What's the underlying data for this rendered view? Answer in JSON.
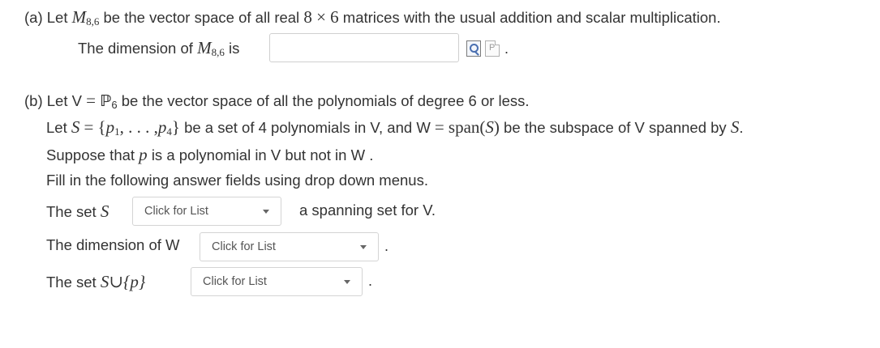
{
  "part_a": {
    "intro_pre": "(a) Let",
    "space_symbol": "M",
    "space_subscript": "8,6",
    "intro_post": "be the vector space of all real",
    "dims_expr": "8 × 6",
    "intro_tail": "matrices with the usual addition and scalar multiplication.",
    "question_pre": "The dimension of",
    "question_post": "is",
    "answer_value": "",
    "help_icon_text": "P",
    "trailing": "."
  },
  "part_b": {
    "line1_pre": "(b) Let V",
    "line1_eq": "=",
    "line1_poly_symbol": "ℙ",
    "line1_poly_sub": "6",
    "line1_post": "be the vector space of all the polynomials of degree 6 or less.",
    "line2_pre": "Let",
    "line2_set": "S",
    "line2_eq": "=",
    "line2_set_expr_open": "{",
    "line2_p1": "p",
    "line2_p1_sub": "1",
    "line2_mid": ", . . . ,",
    "line2_p4": "p",
    "line2_p4_sub": "4",
    "line2_set_expr_close": "}",
    "line2_text": "be a set of 4 polynomials in V, and W",
    "line2_eq2": "=",
    "line2_span": "span(",
    "line2_span_S": "S",
    "line2_span_close": ")",
    "line2_tail": "be the subspace of V spanned by",
    "line2_tail_S": "S",
    "line2_period": ".",
    "line3_pre": "Suppose that",
    "line3_p": "p",
    "line3_post": "is a polynomial in V but not in W .",
    "line4": "Fill in the following answer fields using drop down menus.",
    "q1_pre": "The set",
    "q1_S": "S",
    "q1_dropdown": "Click for List",
    "q1_post": "a spanning set for V.",
    "q2_pre": "The dimension of W",
    "q2_dropdown": "Click for List",
    "q2_post": ".",
    "q3_pre": "The set",
    "q3_expr_S": "S",
    "q3_union": "∪",
    "q3_expr_p": "{p}",
    "q3_dropdown": "Click for List",
    "q3_post": "."
  }
}
